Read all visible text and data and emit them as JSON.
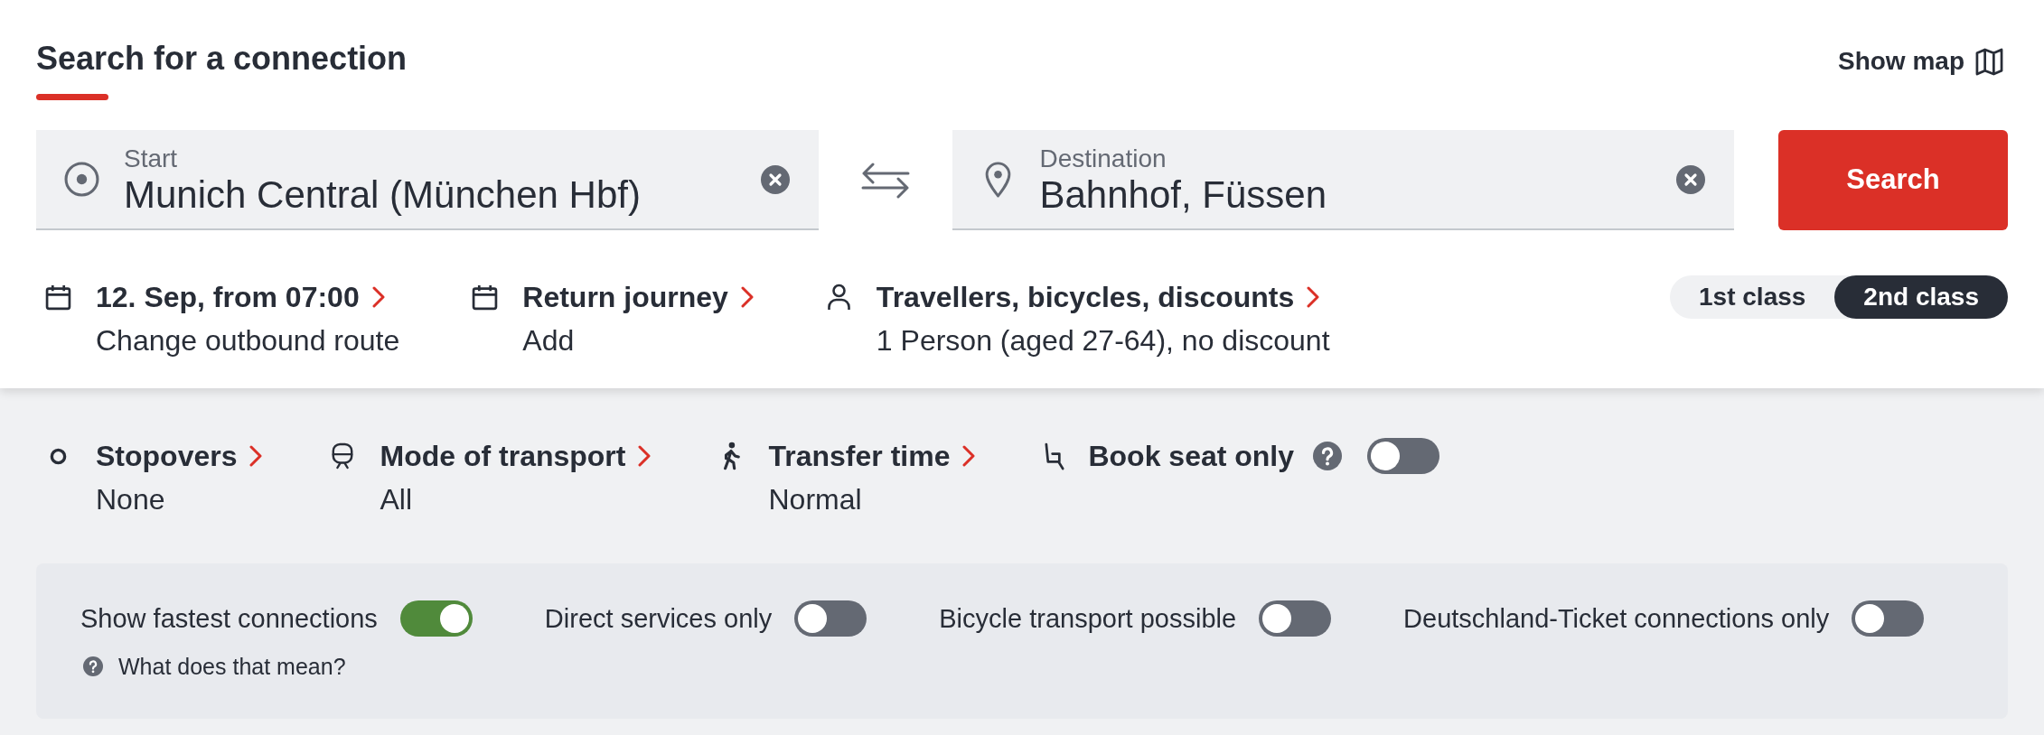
{
  "header": {
    "title": "Search for a connection",
    "map_link": "Show map"
  },
  "locations": [
    {
      "kind": "start",
      "label": "Start",
      "value": "Munich Central (München Hbf)"
    },
    {
      "kind": "destination",
      "label": "Destination",
      "value": "Bahnhof, Füssen"
    }
  ],
  "search_button": "Search",
  "trip_options": [
    {
      "kind": "date",
      "title": "12. Sep, from 07:00",
      "value": "Change outbound route"
    },
    {
      "kind": "return",
      "title": "Return journey",
      "value": "Add"
    },
    {
      "kind": "travellers",
      "title": "Travellers, bicycles, discounts",
      "value": "1 Person (aged 27-64), no discount"
    }
  ],
  "travel_class": [
    {
      "label": "1st class",
      "selected": false
    },
    {
      "label": "2nd class",
      "selected": true
    }
  ],
  "filters": [
    {
      "kind": "stopovers",
      "title": "Stopovers",
      "value": "None"
    },
    {
      "kind": "transport",
      "title": "Mode of transport",
      "value": "All"
    },
    {
      "kind": "transfer",
      "title": "Transfer time",
      "value": "Normal"
    }
  ],
  "seat_option": {
    "label": "Book seat only",
    "on": false
  },
  "toggles": [
    {
      "label": "Show fastest connections",
      "on": true,
      "help": "What does that mean?"
    },
    {
      "label": "Direct services only",
      "on": false
    },
    {
      "label": "Bicycle transport possible",
      "on": false
    },
    {
      "label": "Deutschland-Ticket connections only",
      "on": false
    }
  ]
}
